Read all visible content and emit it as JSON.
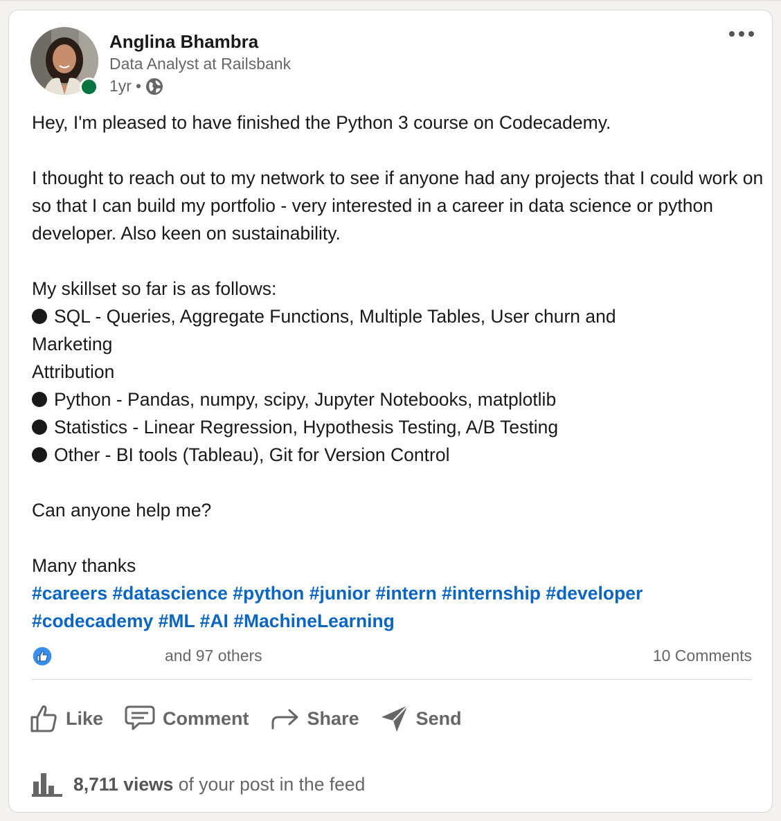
{
  "author": {
    "name": "Anglina Bhambra",
    "headline": "Data Analyst at Railsbank",
    "time": "1yr",
    "separator": "•",
    "visibility_icon": "globe-icon",
    "presence_color": "#057642"
  },
  "post": {
    "intro": "Hey, I'm pleased to have finished the Python 3 course on Codecademy.",
    "paragraph_1": "I thought to reach out to my network to see if anyone had any projects that I could work on so that I can build my portfolio - very interested in a career in data science or python developer. Also keen on sustainability.",
    "skills_heading": "My skillset so far is as follows:",
    "skill_1_line_1": "SQL - Queries, Aggregate Functions, Multiple Tables, User churn and",
    "skill_1_line_2": "Marketing",
    "skill_1_line_3": "Attribution",
    "skill_2": "Python - Pandas, numpy, scipy, Jupyter Notebooks, matplotlib",
    "skill_3": "Statistics - Linear Regression, Hypothesis Testing, A/B Testing",
    "skill_4": "Other - BI tools (Tableau), Git for Version Control",
    "question": "Can anyone help me?",
    "signoff": "Many thanks",
    "hashtags": [
      "#careers",
      "#datascience",
      "#python",
      "#junior",
      "#intern",
      "#internship",
      "#developer",
      "#codecademy",
      "#ML",
      "#AI",
      "#MachineLearning"
    ]
  },
  "social": {
    "reaction_icon": "like-reaction-icon",
    "reactors": "and 97 others",
    "comments": "10 Comments"
  },
  "actions": {
    "like": "Like",
    "comment": "Comment",
    "share": "Share",
    "send": "Send"
  },
  "analytics": {
    "views_bold": "8,711 views",
    "views_rest": "of your post in the feed"
  },
  "colors": {
    "link": "#0a66c2",
    "muted": "#666666",
    "text": "#191919"
  }
}
